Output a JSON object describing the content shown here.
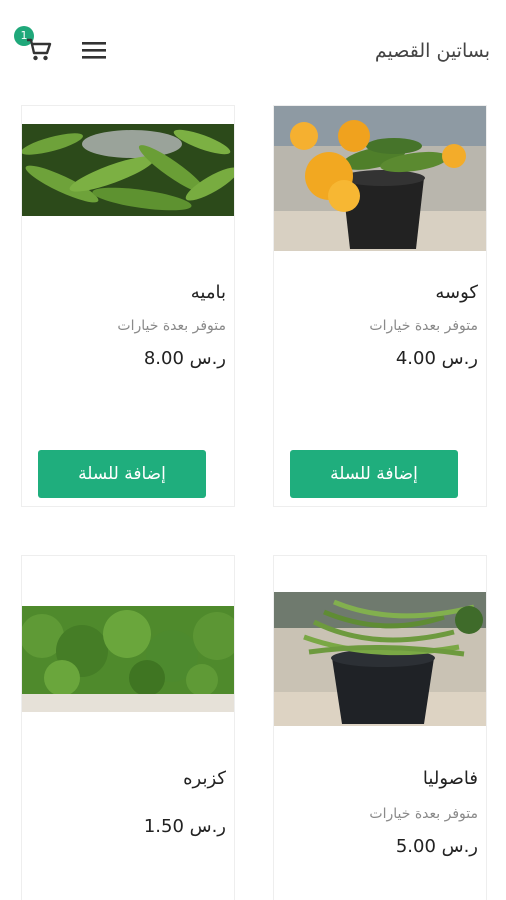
{
  "header": {
    "store_name": "بساتين القصيم",
    "cart_count": "1"
  },
  "products": [
    {
      "name": "كوسه",
      "availability": "متوفر بعدة خيارات",
      "price": "ر.س 4.00",
      "button_label": "إضافة للسلة",
      "image": "zucchini-with-flowers"
    },
    {
      "name": "باميه",
      "availability": "متوفر بعدة خيارات",
      "price": "ر.س 8.00",
      "button_label": "إضافة للسلة",
      "image": "okra"
    },
    {
      "name": "فاصوليا",
      "availability": "متوفر بعدة خيارات",
      "price": "ر.س 5.00",
      "image": "green-beans"
    },
    {
      "name": "كزبره",
      "price": "ر.س 1.50",
      "image": "coriander"
    }
  ],
  "colors": {
    "accent": "#1fae7d",
    "badge": "#1fa87a"
  }
}
